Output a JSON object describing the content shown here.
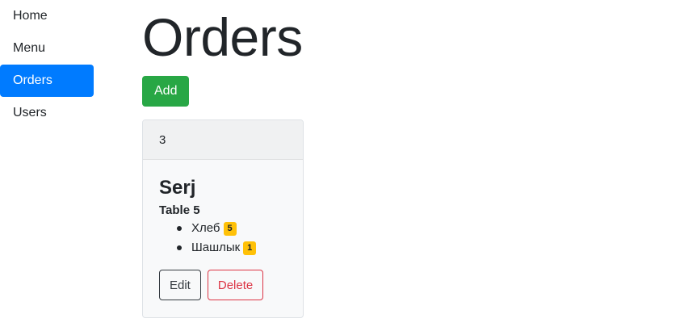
{
  "sidebar": {
    "items": [
      {
        "label": "Home"
      },
      {
        "label": "Menu"
      },
      {
        "label": "Orders",
        "active": true
      },
      {
        "label": "Users"
      }
    ]
  },
  "main": {
    "title": "Orders",
    "add_label": "Add"
  },
  "order": {
    "id": "3",
    "customer": "Serj",
    "table": "Table 5",
    "items": [
      {
        "name": "Хлеб",
        "quantity": "5"
      },
      {
        "name": "Шашлык",
        "quantity": "1"
      }
    ],
    "edit_label": "Edit",
    "delete_label": "Delete"
  },
  "colors": {
    "active_nav": "#007bff",
    "add_button": "#28a745",
    "badge": "#ffc107",
    "delete": "#dc3545"
  }
}
